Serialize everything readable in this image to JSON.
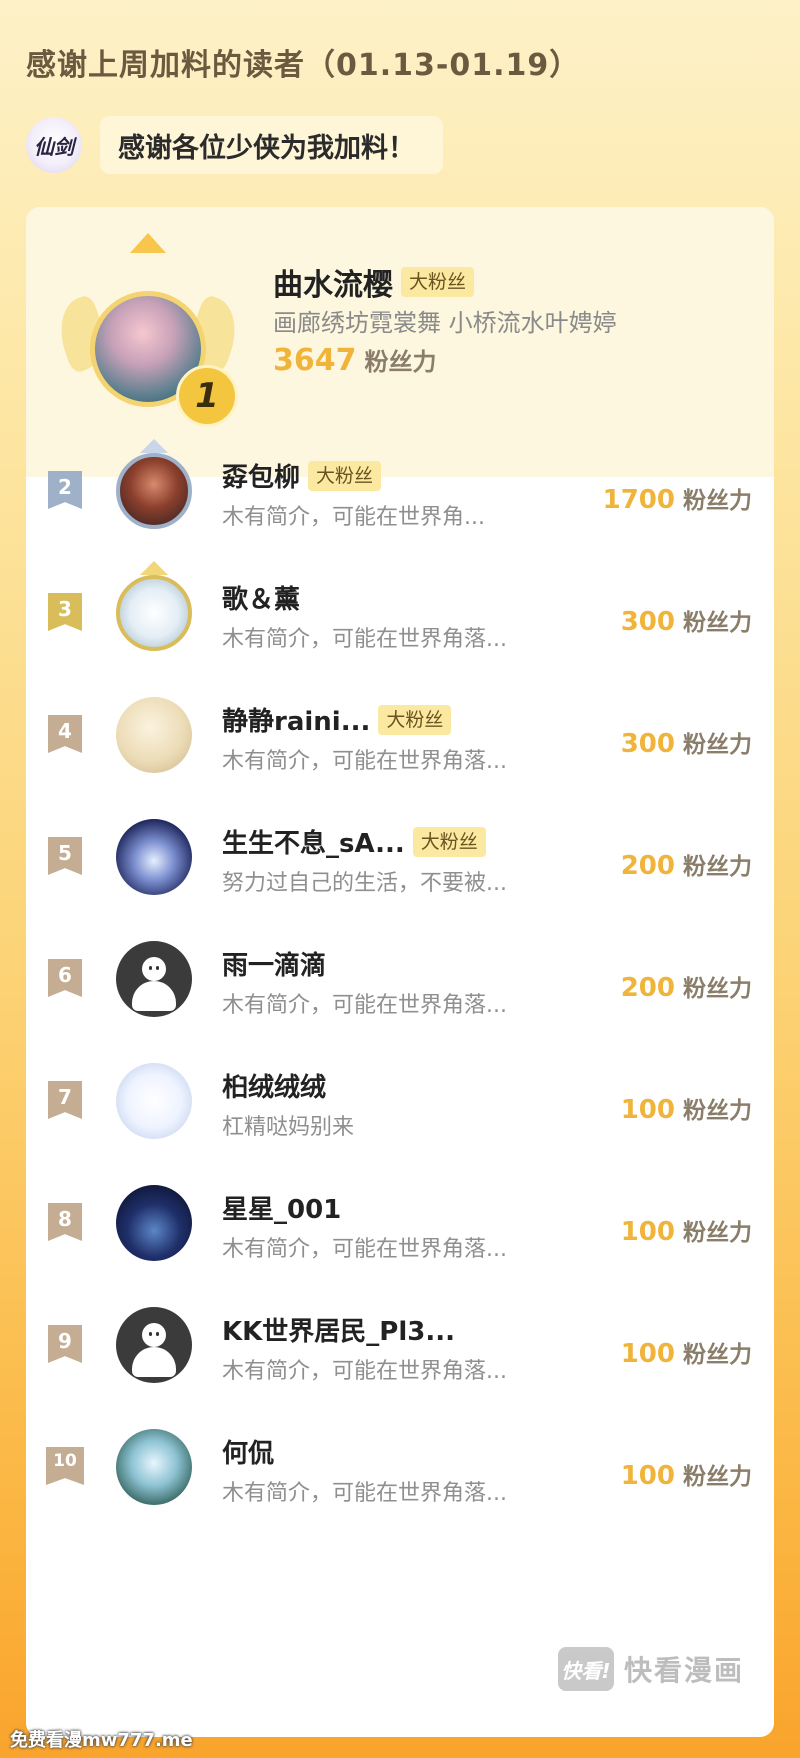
{
  "header": {
    "title": "感谢上周加料的读者（01.13-01.19）",
    "logo_text": "仙剑",
    "thanks_message": "感谢各位少侠为我加料！"
  },
  "unit_label": "粉丝力",
  "top_reader": {
    "rank": "1",
    "name": "曲水流樱",
    "tag": "大粉丝",
    "bio": "画廊绣坊霓裳舞 小桥流水叶娉婷",
    "score": "3647"
  },
  "ranking": [
    {
      "rank": "2",
      "name": "孬包柳",
      "tag": "大粉丝",
      "bio": "木有简介，可能在世界角...",
      "score": "1700"
    },
    {
      "rank": "3",
      "name": "歌＆薰",
      "tag": "",
      "bio": "木有简介，可能在世界角落...",
      "score": "300"
    },
    {
      "rank": "4",
      "name": "静静raini...",
      "tag": "大粉丝",
      "bio": "木有简介，可能在世界角落...",
      "score": "300"
    },
    {
      "rank": "5",
      "name": "生生不息_sA...",
      "tag": "大粉丝",
      "bio": "努力过自己的生活，不要被...",
      "score": "200"
    },
    {
      "rank": "6",
      "name": "雨一滴滴",
      "tag": "",
      "bio": "木有简介，可能在世界角落...",
      "score": "200"
    },
    {
      "rank": "7",
      "name": "桕绒绒绒",
      "tag": "",
      "bio": "杠精哒妈别来",
      "score": "100"
    },
    {
      "rank": "8",
      "name": "星星_001",
      "tag": "",
      "bio": "木有简介，可能在世界角落...",
      "score": "100"
    },
    {
      "rank": "9",
      "name": "KK世界居民_Pl3...",
      "tag": "",
      "bio": "木有简介，可能在世界角落...",
      "score": "100"
    },
    {
      "rank": "10",
      "name": "何侃",
      "tag": "",
      "bio": "木有简介，可能在世界角落...",
      "score": "100"
    }
  ],
  "watermark": {
    "badge": "快看!",
    "text": "快看漫画"
  },
  "footer_text": "免费看漫mw777.me",
  "colors": {
    "accent_gold": "#f0b43a",
    "tag_bg": "#fbe9a2",
    "rank_silver": "#9fb0c9",
    "rank_gold": "#d8bd5a",
    "rank_default": "#c4ad92"
  }
}
